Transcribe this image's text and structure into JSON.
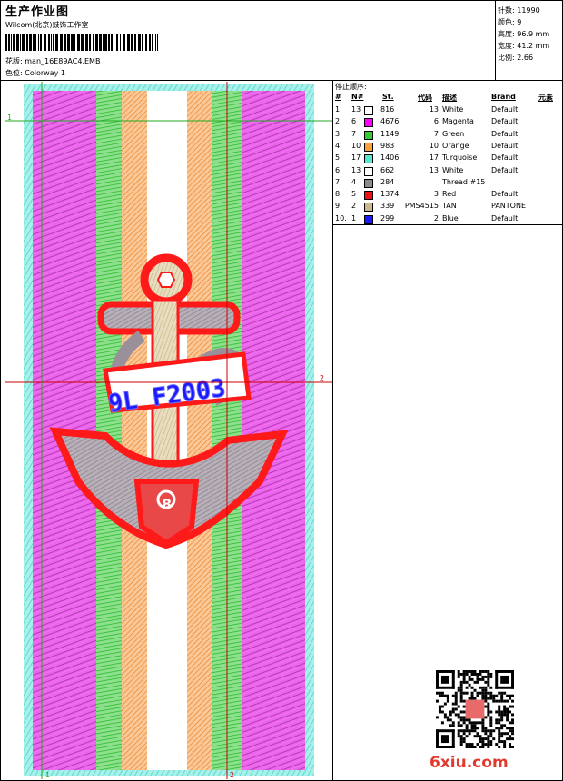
{
  "header": {
    "title": "生产作业图",
    "company": "Wilcom(北京)鼓饰工作室",
    "design_label": "花版:",
    "design_value": "man_16E89AC4.EMB",
    "colorway_label": "色位:",
    "colorway_value": "Colorway 1"
  },
  "stats": [
    {
      "label": "针数:",
      "value": "11990"
    },
    {
      "label": "颜色:",
      "value": "9"
    },
    {
      "label": "高度:",
      "value": "96.9 mm"
    },
    {
      "label": "宽度:",
      "value": "41.2 mm"
    },
    {
      "label": "比例:",
      "value": "2.66"
    }
  ],
  "sequence": {
    "title": "停止顺序:",
    "columns": {
      "num": "#",
      "n": "N#",
      "st": "St.",
      "code": "代码",
      "desc": "描述",
      "brand": "Brand",
      "elem": "元素"
    },
    "rows": [
      {
        "num": "1.",
        "n": "13",
        "st": "816",
        "code": "13",
        "desc": "White",
        "brand": "Default",
        "color": "#ffffff"
      },
      {
        "num": "2.",
        "n": "6",
        "st": "4676",
        "code": "6",
        "desc": "Magenta",
        "brand": "Default",
        "color": "#ff00ff"
      },
      {
        "num": "3.",
        "n": "7",
        "st": "1149",
        "code": "7",
        "desc": "Green",
        "brand": "Default",
        "color": "#33cc33"
      },
      {
        "num": "4.",
        "n": "10",
        "st": "983",
        "code": "10",
        "desc": "Orange",
        "brand": "Default",
        "color": "#f7a03c"
      },
      {
        "num": "5.",
        "n": "17",
        "st": "1406",
        "code": "17",
        "desc": "Turquoise",
        "brand": "Default",
        "color": "#55e8cf"
      },
      {
        "num": "6.",
        "n": "13",
        "st": "662",
        "code": "13",
        "desc": "White",
        "brand": "Default",
        "color": "#ffffff"
      },
      {
        "num": "7.",
        "n": "4",
        "st": "284",
        "code": "",
        "desc": "Thread #15",
        "brand": "",
        "color": "#8c8c8c"
      },
      {
        "num": "8.",
        "n": "5",
        "st": "1374",
        "code": "3",
        "desc": "Red",
        "brand": "Default",
        "color": "#ee1111"
      },
      {
        "num": "9.",
        "n": "2",
        "st": "339",
        "code": "PMS4515",
        "desc": "TAN",
        "brand": "PANTONE",
        "color": "#c9b98a"
      },
      {
        "num": "10.",
        "n": "1",
        "st": "299",
        "code": "2",
        "desc": "Blue",
        "brand": "Default",
        "color": "#1a1aff"
      }
    ]
  },
  "design": {
    "text": "9L F2003",
    "badge": "8",
    "marker_labels": [
      "1",
      "1",
      "2",
      "2"
    ]
  },
  "watermark": "6xiu.com"
}
